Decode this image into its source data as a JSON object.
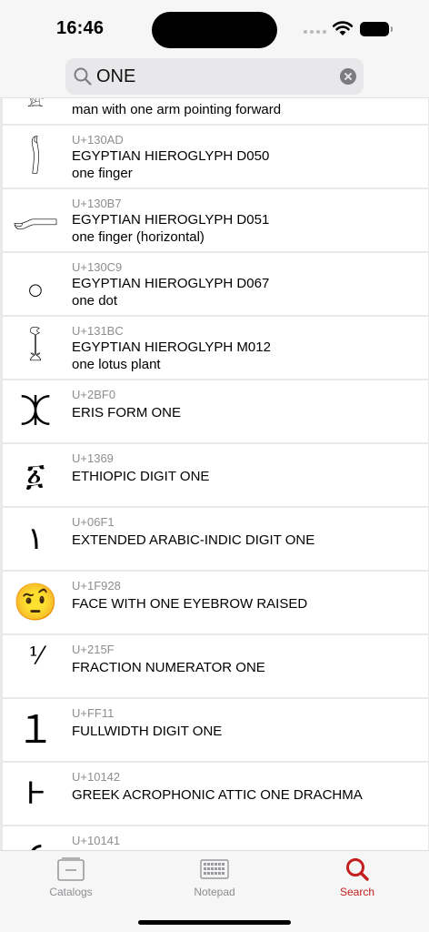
{
  "status": {
    "time": "16:46"
  },
  "search": {
    "query": "ONE"
  },
  "partial_top": {
    "alias": "man with one arm pointing forward",
    "glyph": "𓀀"
  },
  "rows": [
    {
      "code": "U+130AD",
      "name": "EGYPTIAN HIEROGLYPH D050",
      "alias": "one finger",
      "glyph": "𓂭"
    },
    {
      "code": "U+130B7",
      "name": "EGYPTIAN HIEROGLYPH D051",
      "alias": "one finger (horizontal)",
      "glyph": "𓂷"
    },
    {
      "code": "U+130C9",
      "name": "EGYPTIAN HIEROGLYPH D067",
      "alias": "one dot",
      "glyph": "○"
    },
    {
      "code": "U+131BC",
      "name": "EGYPTIAN HIEROGLYPH M012",
      "alias": "one lotus plant",
      "glyph": "𓆼"
    },
    {
      "code": "U+2BF0",
      "name": "ERIS FORM ONE",
      "alias": "",
      "glyph": "⯰"
    },
    {
      "code": "U+1369",
      "name": "ETHIOPIC DIGIT ONE",
      "alias": "",
      "glyph": "፩"
    },
    {
      "code": "U+06F1",
      "name": "EXTENDED ARABIC-INDIC DIGIT ONE",
      "alias": "",
      "glyph": "۱"
    },
    {
      "code": "U+1F928",
      "name": "FACE WITH ONE EYEBROW RAISED",
      "alias": "",
      "glyph": "🤨"
    },
    {
      "code": "U+215F",
      "name": "FRACTION NUMERATOR ONE",
      "alias": "",
      "glyph": "⅟"
    },
    {
      "code": "U+FF11",
      "name": "FULLWIDTH DIGIT ONE",
      "alias": "",
      "glyph": "１"
    },
    {
      "code": "U+10142",
      "name": "GREEK ACROPHONIC ATTIC ONE DRACHMA",
      "alias": "",
      "glyph": "𐅂"
    },
    {
      "code": "U+10141",
      "name": "",
      "alias": "",
      "glyph": "𐅁"
    }
  ],
  "tabs": [
    {
      "label": "Catalogs",
      "icon": "catalogs-icon",
      "active": false
    },
    {
      "label": "Notepad",
      "icon": "notepad-icon",
      "active": false
    },
    {
      "label": "Search",
      "icon": "search-icon",
      "active": true
    }
  ],
  "colors": {
    "accent": "#c41e1e",
    "separator": "#e9e9eb"
  }
}
